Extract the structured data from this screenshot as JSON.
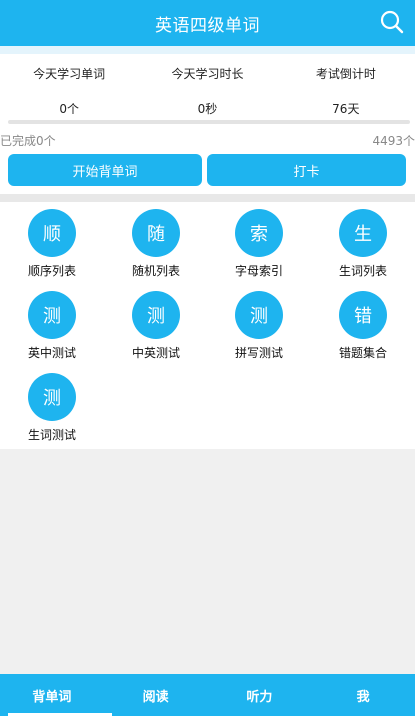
{
  "header": {
    "title": "英语四级单词",
    "search_icon": "search-icon"
  },
  "stats": [
    {
      "label": "今天学习单词",
      "value": "0个"
    },
    {
      "label": "今天学习时长",
      "value": "0秒"
    },
    {
      "label": "考试倒计时",
      "value": "76天"
    }
  ],
  "progress": {
    "done_text": "已完成0个",
    "total_text": "4493个",
    "fraction": 0
  },
  "actions": {
    "start_label": "开始背单词",
    "punch_label": "打卡"
  },
  "menu": [
    {
      "glyph": "顺",
      "label": "顺序列表"
    },
    {
      "glyph": "随",
      "label": "随机列表"
    },
    {
      "glyph": "索",
      "label": "字母索引"
    },
    {
      "glyph": "生",
      "label": "生词列表"
    },
    {
      "glyph": "测",
      "label": "英中测试"
    },
    {
      "glyph": "测",
      "label": "中英测试"
    },
    {
      "glyph": "测",
      "label": "拼写测试"
    },
    {
      "glyph": "错",
      "label": "错题集合"
    },
    {
      "glyph": "测",
      "label": "生词测试"
    }
  ],
  "tabs": [
    {
      "label": "背单词",
      "active": true
    },
    {
      "label": "阅读",
      "active": false
    },
    {
      "label": "听力",
      "active": false
    },
    {
      "label": "我",
      "active": false
    }
  ],
  "colors": {
    "accent": "#1eb4ef"
  }
}
